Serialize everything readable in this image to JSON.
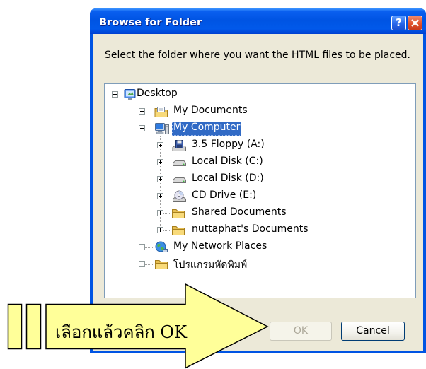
{
  "colors": {
    "dialog_face": "#ECE9D8",
    "title_bar": "#0054E3",
    "selection": "#316AC5",
    "close_button": "#E0522B",
    "callout_fill": "#FFFF99"
  },
  "dialog": {
    "title": "Browse for Folder",
    "title_buttons": {
      "help": "?",
      "help_icon": "help-icon",
      "close_icon": "close-icon"
    },
    "message": "Select the folder where you want the HTML files to be placed.",
    "tree": {
      "root": {
        "label": "Desktop",
        "icon": "desktop-icon",
        "expanded": true,
        "children": [
          {
            "label": "My Documents",
            "icon": "my-documents-icon",
            "expanded": false
          },
          {
            "label": "My Computer",
            "icon": "my-computer-icon",
            "expanded": true,
            "selected": true,
            "children": [
              {
                "label": "3.5 Floppy (A:)",
                "icon": "floppy-drive-icon",
                "expanded": false
              },
              {
                "label": "Local Disk (C:)",
                "icon": "hard-disk-icon",
                "expanded": false
              },
              {
                "label": "Local Disk (D:)",
                "icon": "hard-disk-icon",
                "expanded": false
              },
              {
                "label": "CD Drive (E:)",
                "icon": "cd-drive-icon",
                "expanded": false
              },
              {
                "label": "Shared Documents",
                "icon": "folder-icon",
                "expanded": false
              },
              {
                "label": "nuttaphat's Documents",
                "icon": "folder-icon",
                "expanded": false
              }
            ]
          },
          {
            "label": "My Network Places",
            "icon": "network-places-icon",
            "expanded": false
          },
          {
            "label": "โปรแกรมหัดพิมพ์",
            "icon": "folder-icon",
            "expanded": false
          }
        ]
      }
    },
    "buttons": {
      "ok": {
        "label": "OK",
        "enabled": false
      },
      "cancel": {
        "label": "Cancel",
        "enabled": true
      }
    }
  },
  "callout": {
    "text": "เลือกแล้วคลิก OK"
  }
}
